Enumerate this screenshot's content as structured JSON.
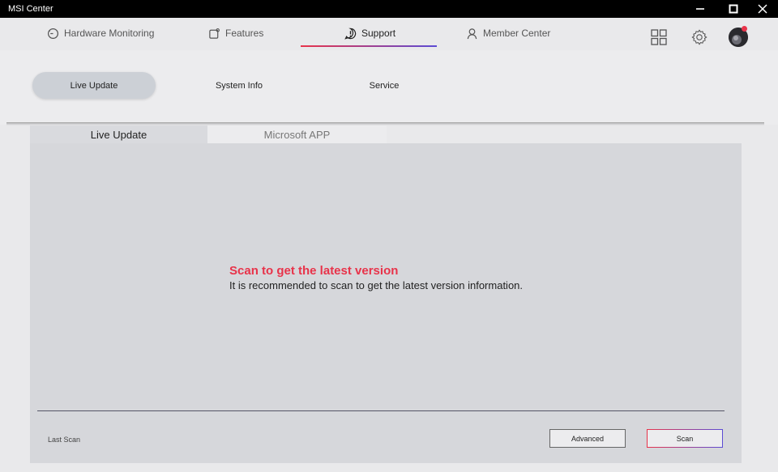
{
  "window": {
    "title": "MSI Center",
    "controls": [
      "minimize-icon",
      "maximize-icon",
      "close-icon"
    ]
  },
  "topnav": {
    "tabs": [
      {
        "label": "Hardware Monitoring",
        "icon": "gauge-icon"
      },
      {
        "label": "Features",
        "icon": "features-icon"
      },
      {
        "label": "Support",
        "icon": "support-icon",
        "active": true
      },
      {
        "label": "Member Center",
        "icon": "user-icon"
      }
    ],
    "actions": [
      "grid-icon",
      "gear-icon",
      "avatar"
    ]
  },
  "subnav": {
    "tabs": [
      {
        "label": "Live Update",
        "active": true
      },
      {
        "label": "System Info"
      },
      {
        "label": "Service"
      }
    ]
  },
  "panel": {
    "tabs": [
      {
        "label": "Live Update",
        "active": true
      },
      {
        "label": "Microsoft APP"
      }
    ],
    "heading": "Scan to get the latest version",
    "message": "It is recommended to scan to get the latest version information.",
    "last_scan_label": "Last Scan",
    "advanced_button": "Advanced",
    "scan_button": "Scan"
  },
  "colors": {
    "accent_red": "#e8334a",
    "accent_purple": "#5b4bd4",
    "titlebar": "#000000"
  }
}
